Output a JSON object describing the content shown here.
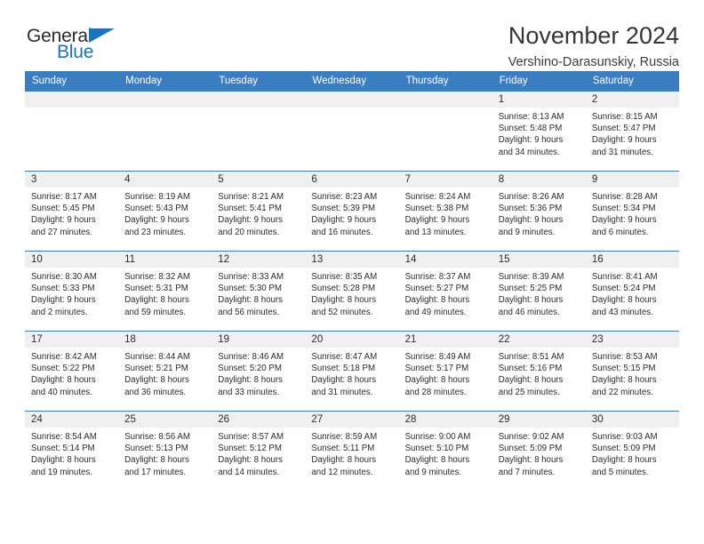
{
  "brand": {
    "name_part1": "General",
    "name_part2": "Blue"
  },
  "header": {
    "title": "November 2024",
    "subtitle": "Vershino-Darasunskiy, Russia"
  },
  "colors": {
    "header_blue": "#3a7dc1",
    "brand_blue": "#1b72bd",
    "daynum_band": "#f0f0f0"
  },
  "weekday_headers": [
    "Sunday",
    "Monday",
    "Tuesday",
    "Wednesday",
    "Thursday",
    "Friday",
    "Saturday"
  ],
  "labels": {
    "sunrise_prefix": "Sunrise:",
    "sunset_prefix": "Sunset:",
    "daylight_prefix": "Daylight:"
  },
  "weeks": [
    [
      {
        "day": "",
        "sunrise": "",
        "sunset": "",
        "daylight_line1": "",
        "daylight_line2": ""
      },
      {
        "day": "",
        "sunrise": "",
        "sunset": "",
        "daylight_line1": "",
        "daylight_line2": ""
      },
      {
        "day": "",
        "sunrise": "",
        "sunset": "",
        "daylight_line1": "",
        "daylight_line2": ""
      },
      {
        "day": "",
        "sunrise": "",
        "sunset": "",
        "daylight_line1": "",
        "daylight_line2": ""
      },
      {
        "day": "",
        "sunrise": "",
        "sunset": "",
        "daylight_line1": "",
        "daylight_line2": ""
      },
      {
        "day": "1",
        "sunrise": "Sunrise: 8:13 AM",
        "sunset": "Sunset: 5:48 PM",
        "daylight_line1": "Daylight: 9 hours",
        "daylight_line2": "and 34 minutes."
      },
      {
        "day": "2",
        "sunrise": "Sunrise: 8:15 AM",
        "sunset": "Sunset: 5:47 PM",
        "daylight_line1": "Daylight: 9 hours",
        "daylight_line2": "and 31 minutes."
      }
    ],
    [
      {
        "day": "3",
        "sunrise": "Sunrise: 8:17 AM",
        "sunset": "Sunset: 5:45 PM",
        "daylight_line1": "Daylight: 9 hours",
        "daylight_line2": "and 27 minutes."
      },
      {
        "day": "4",
        "sunrise": "Sunrise: 8:19 AM",
        "sunset": "Sunset: 5:43 PM",
        "daylight_line1": "Daylight: 9 hours",
        "daylight_line2": "and 23 minutes."
      },
      {
        "day": "5",
        "sunrise": "Sunrise: 8:21 AM",
        "sunset": "Sunset: 5:41 PM",
        "daylight_line1": "Daylight: 9 hours",
        "daylight_line2": "and 20 minutes."
      },
      {
        "day": "6",
        "sunrise": "Sunrise: 8:23 AM",
        "sunset": "Sunset: 5:39 PM",
        "daylight_line1": "Daylight: 9 hours",
        "daylight_line2": "and 16 minutes."
      },
      {
        "day": "7",
        "sunrise": "Sunrise: 8:24 AM",
        "sunset": "Sunset: 5:38 PM",
        "daylight_line1": "Daylight: 9 hours",
        "daylight_line2": "and 13 minutes."
      },
      {
        "day": "8",
        "sunrise": "Sunrise: 8:26 AM",
        "sunset": "Sunset: 5:36 PM",
        "daylight_line1": "Daylight: 9 hours",
        "daylight_line2": "and 9 minutes."
      },
      {
        "day": "9",
        "sunrise": "Sunrise: 8:28 AM",
        "sunset": "Sunset: 5:34 PM",
        "daylight_line1": "Daylight: 9 hours",
        "daylight_line2": "and 6 minutes."
      }
    ],
    [
      {
        "day": "10",
        "sunrise": "Sunrise: 8:30 AM",
        "sunset": "Sunset: 5:33 PM",
        "daylight_line1": "Daylight: 9 hours",
        "daylight_line2": "and 2 minutes."
      },
      {
        "day": "11",
        "sunrise": "Sunrise: 8:32 AM",
        "sunset": "Sunset: 5:31 PM",
        "daylight_line1": "Daylight: 8 hours",
        "daylight_line2": "and 59 minutes."
      },
      {
        "day": "12",
        "sunrise": "Sunrise: 8:33 AM",
        "sunset": "Sunset: 5:30 PM",
        "daylight_line1": "Daylight: 8 hours",
        "daylight_line2": "and 56 minutes."
      },
      {
        "day": "13",
        "sunrise": "Sunrise: 8:35 AM",
        "sunset": "Sunset: 5:28 PM",
        "daylight_line1": "Daylight: 8 hours",
        "daylight_line2": "and 52 minutes."
      },
      {
        "day": "14",
        "sunrise": "Sunrise: 8:37 AM",
        "sunset": "Sunset: 5:27 PM",
        "daylight_line1": "Daylight: 8 hours",
        "daylight_line2": "and 49 minutes."
      },
      {
        "day": "15",
        "sunrise": "Sunrise: 8:39 AM",
        "sunset": "Sunset: 5:25 PM",
        "daylight_line1": "Daylight: 8 hours",
        "daylight_line2": "and 46 minutes."
      },
      {
        "day": "16",
        "sunrise": "Sunrise: 8:41 AM",
        "sunset": "Sunset: 5:24 PM",
        "daylight_line1": "Daylight: 8 hours",
        "daylight_line2": "and 43 minutes."
      }
    ],
    [
      {
        "day": "17",
        "sunrise": "Sunrise: 8:42 AM",
        "sunset": "Sunset: 5:22 PM",
        "daylight_line1": "Daylight: 8 hours",
        "daylight_line2": "and 40 minutes."
      },
      {
        "day": "18",
        "sunrise": "Sunrise: 8:44 AM",
        "sunset": "Sunset: 5:21 PM",
        "daylight_line1": "Daylight: 8 hours",
        "daylight_line2": "and 36 minutes."
      },
      {
        "day": "19",
        "sunrise": "Sunrise: 8:46 AM",
        "sunset": "Sunset: 5:20 PM",
        "daylight_line1": "Daylight: 8 hours",
        "daylight_line2": "and 33 minutes."
      },
      {
        "day": "20",
        "sunrise": "Sunrise: 8:47 AM",
        "sunset": "Sunset: 5:18 PM",
        "daylight_line1": "Daylight: 8 hours",
        "daylight_line2": "and 31 minutes."
      },
      {
        "day": "21",
        "sunrise": "Sunrise: 8:49 AM",
        "sunset": "Sunset: 5:17 PM",
        "daylight_line1": "Daylight: 8 hours",
        "daylight_line2": "and 28 minutes."
      },
      {
        "day": "22",
        "sunrise": "Sunrise: 8:51 AM",
        "sunset": "Sunset: 5:16 PM",
        "daylight_line1": "Daylight: 8 hours",
        "daylight_line2": "and 25 minutes."
      },
      {
        "day": "23",
        "sunrise": "Sunrise: 8:53 AM",
        "sunset": "Sunset: 5:15 PM",
        "daylight_line1": "Daylight: 8 hours",
        "daylight_line2": "and 22 minutes."
      }
    ],
    [
      {
        "day": "24",
        "sunrise": "Sunrise: 8:54 AM",
        "sunset": "Sunset: 5:14 PM",
        "daylight_line1": "Daylight: 8 hours",
        "daylight_line2": "and 19 minutes."
      },
      {
        "day": "25",
        "sunrise": "Sunrise: 8:56 AM",
        "sunset": "Sunset: 5:13 PM",
        "daylight_line1": "Daylight: 8 hours",
        "daylight_line2": "and 17 minutes."
      },
      {
        "day": "26",
        "sunrise": "Sunrise: 8:57 AM",
        "sunset": "Sunset: 5:12 PM",
        "daylight_line1": "Daylight: 8 hours",
        "daylight_line2": "and 14 minutes."
      },
      {
        "day": "27",
        "sunrise": "Sunrise: 8:59 AM",
        "sunset": "Sunset: 5:11 PM",
        "daylight_line1": "Daylight: 8 hours",
        "daylight_line2": "and 12 minutes."
      },
      {
        "day": "28",
        "sunrise": "Sunrise: 9:00 AM",
        "sunset": "Sunset: 5:10 PM",
        "daylight_line1": "Daylight: 8 hours",
        "daylight_line2": "and 9 minutes."
      },
      {
        "day": "29",
        "sunrise": "Sunrise: 9:02 AM",
        "sunset": "Sunset: 5:09 PM",
        "daylight_line1": "Daylight: 8 hours",
        "daylight_line2": "and 7 minutes."
      },
      {
        "day": "30",
        "sunrise": "Sunrise: 9:03 AM",
        "sunset": "Sunset: 5:09 PM",
        "daylight_line1": "Daylight: 8 hours",
        "daylight_line2": "and 5 minutes."
      }
    ]
  ]
}
